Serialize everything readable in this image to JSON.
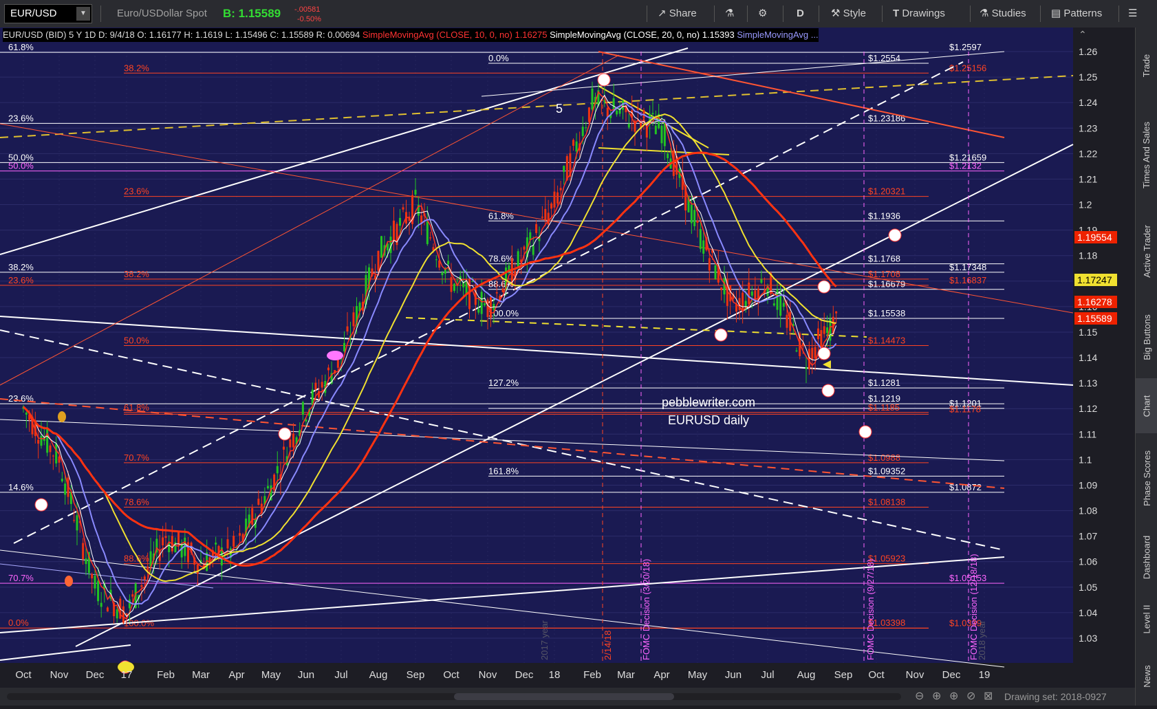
{
  "toolbar": {
    "symbol": "EUR/USD",
    "description": "Euro/USDollar Spot",
    "bid": "B: 1.15589",
    "change": "-.00581",
    "change_pct": "-0.50%",
    "share": "Share",
    "period": "D",
    "style": "Style",
    "drawings": "Drawings",
    "studies": "Studies",
    "patterns": "Patterns"
  },
  "header_line": {
    "instrument": "EUR/USD (BID) 5 Y 1D",
    "d": "D: 9/4/18",
    "o": "O: 1.16177",
    "h": "H: 1.1619",
    "l": "L: 1.15496",
    "c": "C: 1.15589",
    "r": "R: 0.00694",
    "sma10": "SimpleMovingAvg (CLOSE, 10, 0, no)",
    "sma10_val": "1.16275",
    "sma20": "SimpleMovingAvg (CLOSE, 20, 0, no)",
    "sma20_val": "1.15393",
    "sma_more": "SimpleMovingAvg ..."
  },
  "sidebar": [
    "Trade",
    "Times And Sales",
    "Active Trader",
    "Big Buttons",
    "Chart",
    "Phase Scores",
    "Dashboard",
    "Level II",
    "News"
  ],
  "footer": {
    "drawing_set": "Drawing set: 2018-0927"
  },
  "watermark": {
    "line1": "pebblewriter.com",
    "line2": "EURUSD daily"
  },
  "labels": {
    "wave5": "5",
    "fomc1": "FOMC Decision (3/20/18)",
    "fomc2": "FOMC Decision (9/27/18)",
    "fomc3": "FOMC Decision (12/18/18)",
    "date_mark": "2/14/18",
    "year2017": "2017 year",
    "year_next": "2018 year"
  },
  "colors": {
    "bg": "#1a1a52",
    "white": "#ffffff",
    "red": "#ff4422",
    "magenta": "#ff66ff",
    "yellow": "#f0e030",
    "blue": "#8080ff",
    "green": "#22c422"
  },
  "chart_data": {
    "type": "line",
    "title": "EUR/USD (BID) 5 Y 1D",
    "ylim": [
      1.024,
      1.268
    ],
    "x_ticks": [
      "Oct",
      "Nov",
      "Dec",
      "17",
      "Feb",
      "Mar",
      "Apr",
      "May",
      "Jun",
      "Jul",
      "Aug",
      "Sep",
      "Oct",
      "Nov",
      "Dec",
      "18",
      "Feb",
      "Mar",
      "Apr",
      "May",
      "Jun",
      "Jul",
      "Aug",
      "Sep",
      "Oct",
      "Nov",
      "Dec",
      "19"
    ],
    "y_ticks": [
      "1.26",
      "1.25",
      "1.24",
      "1.23",
      "1.22",
      "1.21",
      "1.2",
      "1.19",
      "1.18",
      "1.17",
      "1.16",
      "1.15",
      "1.14",
      "1.13",
      "1.12",
      "1.11",
      "1.1",
      "1.09",
      "1.08",
      "1.07",
      "1.06",
      "1.05",
      "1.04",
      "1.03"
    ],
    "series": [
      {
        "x": [
          "Oct",
          "Nov",
          "Dec",
          "17",
          "Feb",
          "Mar",
          "Apr",
          "May",
          "Jun",
          "Jul",
          "Aug",
          "Sep",
          "Oct",
          "Nov",
          "Dec",
          "18",
          "Feb",
          "Mar",
          "Apr",
          "May",
          "Jun",
          "Jul",
          "Aug",
          "Sep"
        ],
        "values": [
          1.12,
          1.1,
          1.05,
          1.04,
          1.07,
          1.06,
          1.065,
          1.09,
          1.12,
          1.14,
          1.18,
          1.2,
          1.17,
          1.16,
          1.18,
          1.2,
          1.24,
          1.235,
          1.23,
          1.19,
          1.16,
          1.17,
          1.14,
          1.156
        ]
      }
    ],
    "price_tags": [
      {
        "value": "1.19554",
        "color": "#ee2200"
      },
      {
        "value": "1.17247",
        "color": "#f0e030"
      },
      {
        "value": "1.16278",
        "color": "#ee2200"
      },
      {
        "value": "1.15589",
        "color": "#ee2200"
      }
    ],
    "levels": [
      {
        "price": 1.2597,
        "label": "$1.2597",
        "color": "#ffffff",
        "fib": "61.8%"
      },
      {
        "price": 1.2554,
        "label": "$1.2554",
        "color": "#ffffff",
        "fib": "0.0%"
      },
      {
        "price": 1.25156,
        "label": "$1.25156",
        "color": "#ff4422",
        "fib": "38.2%"
      },
      {
        "price": 1.23186,
        "label": "$1.23186",
        "color": "#ffffff",
        "fib": "23.6%"
      },
      {
        "price": 1.2165,
        "label": "$1.21659",
        "color": "#ffffff",
        "fib": "50.0%"
      },
      {
        "price": 1.2132,
        "label": "$1.2132",
        "color": "#ff66ff",
        "fib": "50.0%"
      },
      {
        "price": 1.20321,
        "label": "$1.20321",
        "color": "#ff4422",
        "fib": "23.6%"
      },
      {
        "price": 1.1936,
        "label": "$1.1936",
        "color": "#ffffff",
        "fib": "61.8%"
      },
      {
        "price": 1.1768,
        "label": "$1.1768",
        "color": "#ffffff",
        "fib": "78.6%"
      },
      {
        "price": 1.17348,
        "label": "$1.17348",
        "color": "#ffffff",
        "fib": "38.2%"
      },
      {
        "price": 1.1708,
        "label": "$1.1708",
        "color": "#ff4422",
        "fib": "38.2%"
      },
      {
        "price": 1.16837,
        "label": "$1.16837",
        "color": "#ff4422",
        "fib": "23.6%"
      },
      {
        "price": 1.16679,
        "label": "$1.16679",
        "color": "#ffffff",
        "fib": "88.6%"
      },
      {
        "price": 1.15538,
        "label": "$1.15538",
        "color": "#ffffff",
        "fib": "100.0%"
      },
      {
        "price": 1.14473,
        "label": "$1.14473",
        "color": "#ff4422",
        "fib": "50.0%"
      },
      {
        "price": 1.1281,
        "label": "$1.1281",
        "color": "#ffffff",
        "fib": "127.2%"
      },
      {
        "price": 1.1219,
        "label": "$1.1219",
        "color": "#ffffff",
        "fib": "23.6%"
      },
      {
        "price": 1.1201,
        "label": "$1.1201",
        "color": "#ffffff",
        "fib": ""
      },
      {
        "price": 1.1185,
        "label": "$1.1185",
        "color": "#ff4422",
        "fib": "61.8%"
      },
      {
        "price": 1.1178,
        "label": "$1.1178",
        "color": "#ff4422",
        "fib": ""
      },
      {
        "price": 1.0988,
        "label": "$1.0988",
        "color": "#ff4422",
        "fib": "70.7%"
      },
      {
        "price": 1.09352,
        "label": "$1.09352",
        "color": "#ffffff",
        "fib": "161.8%"
      },
      {
        "price": 1.0872,
        "label": "$1.0872",
        "color": "#ffffff",
        "fib": "14.6%"
      },
      {
        "price": 1.08138,
        "label": "$1.08138",
        "color": "#ff4422",
        "fib": "78.6%"
      },
      {
        "price": 1.05923,
        "label": "$1.05923",
        "color": "#ff4422",
        "fib": "88.6%"
      },
      {
        "price": 1.05153,
        "label": "$1.05153",
        "color": "#ff66ff",
        "fib": "70.7%"
      },
      {
        "price": 1.03398,
        "label": "$1.03398",
        "color": "#ff4422",
        "fib": "0.0%"
      },
      {
        "price": 1.0339,
        "label": "$1.0339",
        "color": "#ff4422",
        "fib": "100.0%"
      }
    ]
  }
}
